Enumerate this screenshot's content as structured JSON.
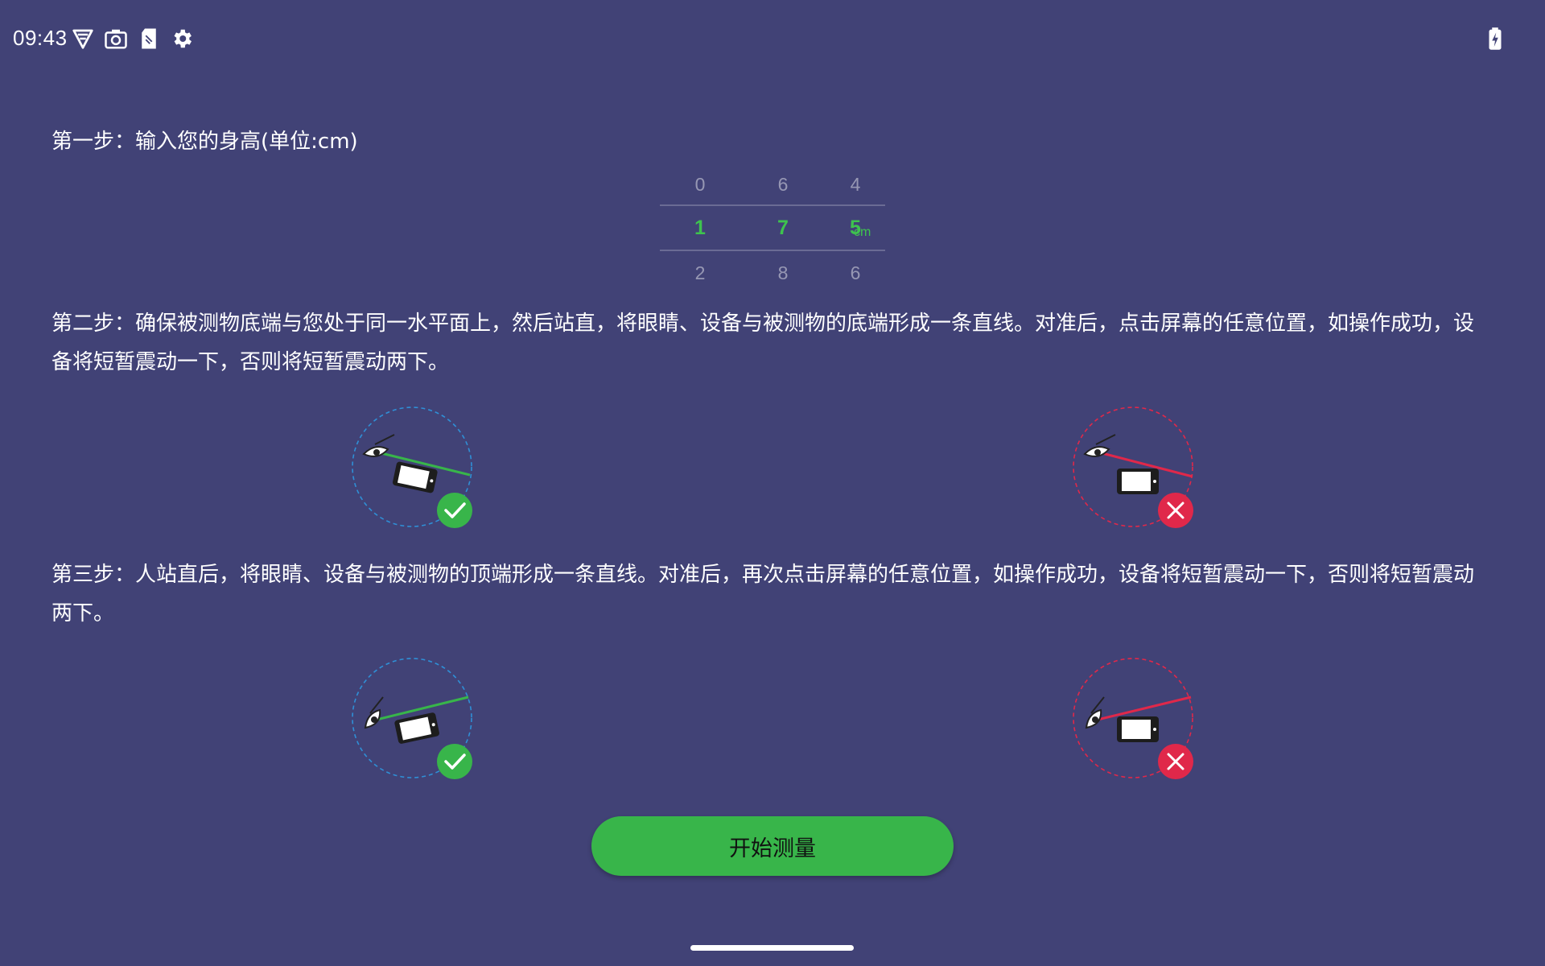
{
  "status_bar": {
    "time": "09:43",
    "icons": [
      "vpn-shield-icon",
      "camera-icon",
      "sd-card-icon",
      "settings-gear-icon",
      "battery-charging-icon"
    ]
  },
  "steps": {
    "step1": "第一步：输入您的身高(单位:cm)",
    "step2": "第二步：确保被测物底端与您处于同一水平面上，然后站直，将眼睛、设备与被测物的底端形成一条直线。对准后，点击屏幕的任意位置，如操作成功，设备将短暂震动一下，否则将短暂震动两下。",
    "step3": "第三步：人站直后，将眼睛、设备与被测物的顶端形成一条直线。对准后，再次点击屏幕的任意位置，如操作成功，设备将短暂震动一下，否则将短暂震动两下。"
  },
  "height_picker": {
    "hundreds": {
      "prev": "0",
      "selected": "1",
      "next": "2"
    },
    "tens": {
      "prev": "6",
      "selected": "7",
      "next": "8"
    },
    "ones": {
      "prev": "4",
      "selected": "5",
      "next": "6"
    },
    "unit": "cm"
  },
  "colors": {
    "background": "#414276",
    "accent_green": "#38b54a",
    "error_red": "#e0284a",
    "correct_ring": "#2f8fd6",
    "wrong_ring": "#e0284a"
  },
  "start_button": {
    "label": "开始测量"
  }
}
